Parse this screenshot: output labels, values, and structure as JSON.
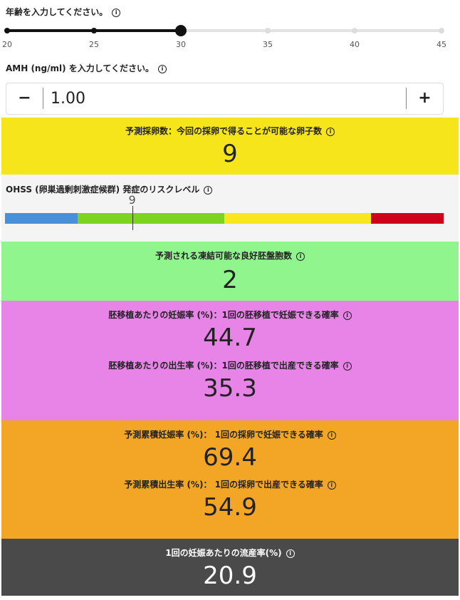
{
  "age": {
    "label": "年齢を入力してください。",
    "min": 20,
    "max": 45,
    "value": 30,
    "ticks": [
      "20",
      "25",
      "30",
      "35",
      "40",
      "45"
    ]
  },
  "amh": {
    "label": "AMH (ng/ml) を入力してください。",
    "value": "1.00",
    "minus_label": "−",
    "plus_label": "+"
  },
  "results": {
    "eggs": {
      "title": "予測採卵数：今回の採卵で得ることが可能な卵子数",
      "value": "9"
    },
    "ohss": {
      "title": "OHSS (卵巣過剰刺激症候群) 発症のリスクレベル",
      "marker_label": "9",
      "marker_fraction": 0.29
    },
    "blastocysts": {
      "title": "予測される凍結可能な良好胚盤胞数",
      "value": "2"
    },
    "pregnancy_per_transfer": {
      "title": "胚移植あたりの妊娠率 (%)：1回の胚移植で妊娠できる確率",
      "value": "44.7"
    },
    "birth_per_transfer": {
      "title": "胚移植あたりの出生率 (%)：1回の胚移植で出産できる確率",
      "value": "35.3"
    },
    "cumulative_pregnancy": {
      "title": "予測累積妊娠率 (%)： 1回の採卵で妊娠できる確率",
      "value": "69.4"
    },
    "cumulative_birth": {
      "title": "予測累積出生率 (%)： 1回の採卵で出産できる確率",
      "value": "54.9"
    },
    "miscarriage": {
      "title": "1回の妊娠あたりの流産率(%)",
      "value": "20.9"
    }
  },
  "colors": {
    "eggs_bg": "#f7e51c",
    "blastocysts_bg": "#90f58c",
    "transfer_bg": "#e883e8",
    "cumulative_bg": "#f3a626",
    "miscarriage_bg": "#4a4a4a",
    "risk_segments": [
      "#4a90d9",
      "#7ed321",
      "#f8e71c",
      "#d0021b"
    ]
  },
  "icons": {
    "info": "info-circle-icon"
  }
}
